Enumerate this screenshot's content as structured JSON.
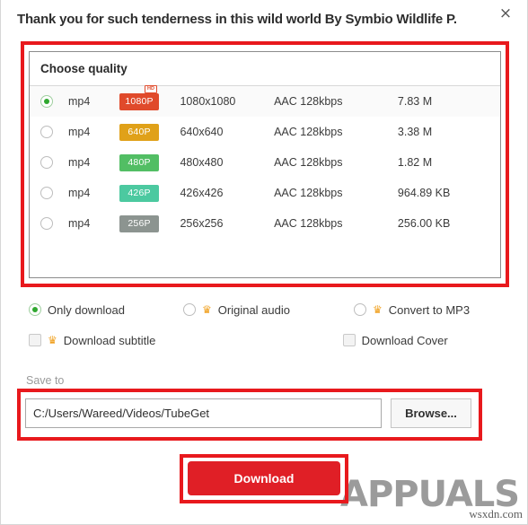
{
  "dialog": {
    "title": "Thank you for such tenderness in this wild world  By Symbio Wildlife P.",
    "close_icon": "×"
  },
  "quality": {
    "header": "Choose quality",
    "hd_tag": "HD",
    "rows": [
      {
        "format": "mp4",
        "badge": "1080P",
        "badge_color": "#e04a2b",
        "resolution": "1080x1080",
        "audio": "AAC 128kbps",
        "size": "7.83 M",
        "selected": true,
        "hd": true
      },
      {
        "format": "mp4",
        "badge": "640P",
        "badge_color": "#e0a119",
        "resolution": "640x640",
        "audio": "AAC 128kbps",
        "size": "3.38 M",
        "selected": false,
        "hd": false
      },
      {
        "format": "mp4",
        "badge": "480P",
        "badge_color": "#52be64",
        "resolution": "480x480",
        "audio": "AAC 128kbps",
        "size": "1.82 M",
        "selected": false,
        "hd": false
      },
      {
        "format": "mp4",
        "badge": "426P",
        "badge_color": "#4cc9a0",
        "resolution": "426x426",
        "audio": "AAC 128kbps",
        "size": "964.89 KB",
        "selected": false,
        "hd": false
      },
      {
        "format": "mp4",
        "badge": "256P",
        "badge_color": "#8c9490",
        "resolution": "256x256",
        "audio": "AAC 128kbps",
        "size": "256.00 KB",
        "selected": false,
        "hd": false
      }
    ]
  },
  "options": {
    "only_download": {
      "label": "Only download",
      "type": "radio",
      "checked": true,
      "premium": false
    },
    "original_audio": {
      "label": "Original audio",
      "type": "radio",
      "checked": false,
      "premium": true
    },
    "convert_mp3": {
      "label": "Convert to MP3",
      "type": "radio",
      "checked": false,
      "premium": true
    },
    "download_subtitle": {
      "label": "Download subtitle",
      "type": "checkbox",
      "checked": false,
      "premium": true
    },
    "download_cover": {
      "label": "Download Cover",
      "type": "checkbox",
      "checked": false,
      "premium": false
    },
    "crown_icon": "♛"
  },
  "save": {
    "label": "Save to",
    "path": "C:/Users/Wareed/Videos/TubeGet",
    "browse_label": "Browse..."
  },
  "actions": {
    "download_label": "Download"
  },
  "watermark": {
    "brand": "APPUALS",
    "site": "wsxdn.com"
  },
  "colors": {
    "accent_red": "#e01f26",
    "annotation_red": "#e8191d",
    "crown_gold": "#f0a01e",
    "radio_green": "#2fa82f"
  }
}
